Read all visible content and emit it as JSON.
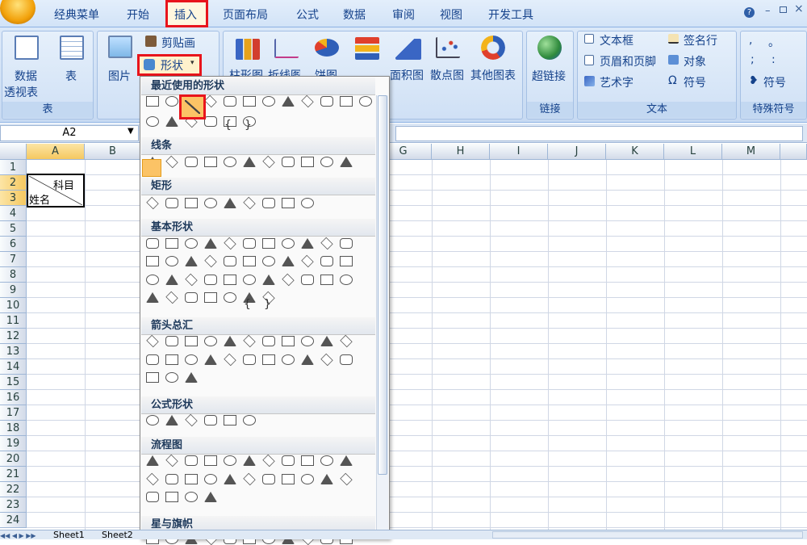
{
  "tabs": [
    "经典菜单",
    "开始",
    "插入",
    "页面布局",
    "公式",
    "数据",
    "审阅",
    "视图",
    "开发工具"
  ],
  "active_tab": "插入",
  "ribbon": {
    "table_group": {
      "pivot_label_1": "数据",
      "pivot_label_2": "透视表",
      "table_label": "表",
      "group_label": "表"
    },
    "illustrations": {
      "picture_label": "图片",
      "clipart_label": "剪贴画",
      "shapes_label": "形状"
    },
    "charts": {
      "column_label": "柱形图",
      "line_label": "折线图",
      "pie_label": "饼图",
      "bar_label": "条形图",
      "area_label": "面积图",
      "scatter_label": "散点图",
      "other_label": "其他图表"
    },
    "links": {
      "hyperlink_label": "超链接",
      "group_label": "链接"
    },
    "text": {
      "textbox_label": "文本框",
      "header_footer_label": "页眉和页脚",
      "wordart_label": "艺术字",
      "signature_label": "签名行",
      "object_label": "对象",
      "symbol_label": "符号",
      "group_label": "文本"
    },
    "special": {
      "symbol_label": "符号",
      "group_label": "特殊符号",
      "chars": [
        ",",
        "。",
        ";",
        ":"
      ]
    }
  },
  "name_box": "A2",
  "columns": [
    "A",
    "B",
    "G",
    "H",
    "I",
    "J",
    "K",
    "L",
    "M"
  ],
  "rows": [
    "1",
    "2",
    "3",
    "4",
    "5",
    "6",
    "7",
    "8",
    "9",
    "10",
    "11",
    "12",
    "13",
    "14",
    "15",
    "16",
    "17",
    "18",
    "19",
    "20",
    "21",
    "22",
    "23",
    "24"
  ],
  "cells": {
    "A2": "科目",
    "A3": "姓名"
  },
  "shapes_menu": {
    "sections": [
      "最近使用的形状",
      "线条",
      "矩形",
      "基本形状",
      "箭头总汇",
      "公式形状",
      "流程图",
      "星与旗帜"
    ],
    "brace_glyphs": [
      "{",
      "}",
      "{",
      "}"
    ]
  },
  "sheets": [
    "Sheet1",
    "Sheet2"
  ],
  "colors": {
    "highlight": "#e8141c",
    "ribbon": "#c7daf2",
    "accent_orange": "#f5a623"
  }
}
